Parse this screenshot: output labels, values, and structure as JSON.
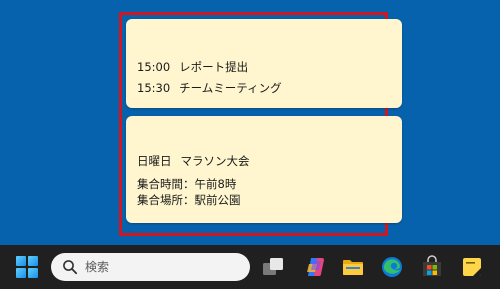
{
  "notes": [
    {
      "lines": [
        {
          "time": "15:00",
          "text": "レポート提出"
        },
        {
          "time": "15:30",
          "text": "チームミーティング"
        }
      ]
    },
    {
      "lines": [
        {
          "day": "日曜日",
          "text": "マラソン大会"
        },
        {
          "text": "集合時間：午前8時"
        },
        {
          "text": "集合場所：駅前公園"
        }
      ]
    }
  ],
  "taskbar": {
    "search": {
      "placeholder": "検索"
    },
    "icons": [
      "start-icon",
      "task-view-icon",
      "copilot-icon",
      "file-explorer-icon",
      "edge-icon",
      "microsoft-store-icon",
      "sticky-notes-icon"
    ]
  },
  "colors": {
    "desktop": "#0762ad",
    "note": "#fff6cf",
    "highlight": "#d0161e",
    "taskbar": "#202020"
  }
}
